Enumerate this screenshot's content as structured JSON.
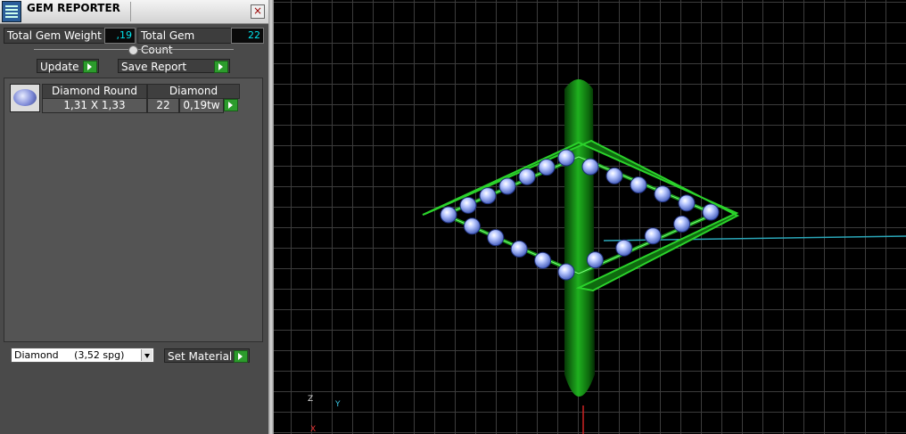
{
  "panel": {
    "title": "GEM REPORTER",
    "close_label": "×",
    "total_weight_label": "Total Gem Weight",
    "total_weight_value": ",19",
    "total_count_label": "Total Gem Count",
    "total_count_value": "22",
    "update_label": "Update",
    "save_report_label": "Save Report"
  },
  "gem_table": {
    "headers": [
      "Diamond Round",
      "Diamond"
    ],
    "rows": [
      {
        "size": "1,31 X 1,33",
        "count": "22",
        "weight": "0,19tw"
      }
    ]
  },
  "material": {
    "selected": "Diamond     (3,52 spg)",
    "set_label": "Set Material"
  },
  "viewport": {
    "axis_z": "Z",
    "axis_y": "Y",
    "axis_x": "X"
  },
  "colors": {
    "gem_value": "#00e5ee",
    "go_button": "#2c9c2c",
    "ring_green": "#1fa01f",
    "gem_blue": "#8fa8ff"
  }
}
